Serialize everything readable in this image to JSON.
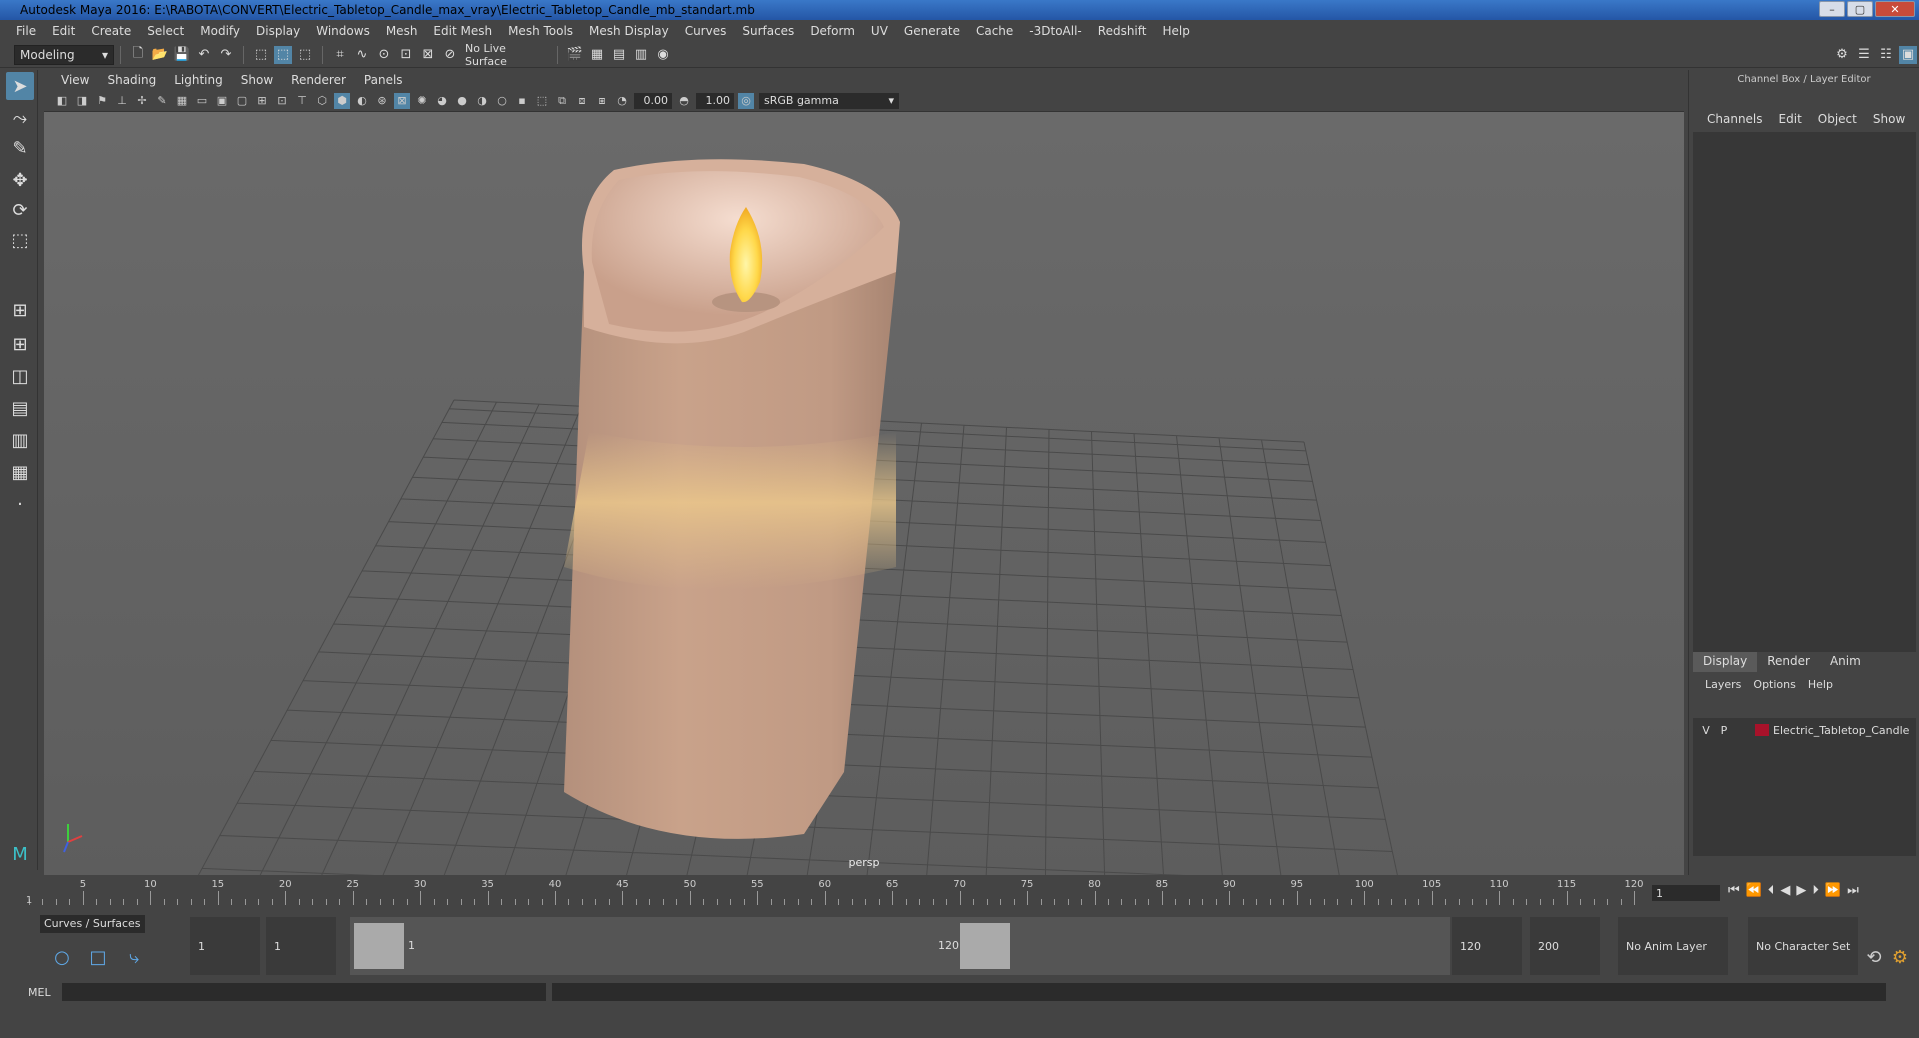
{
  "window": {
    "title": "Autodesk Maya 2016: E:\\RABOTA\\CONVERT\\Electric_Tabletop_Candle_max_vray\\Electric_Tabletop_Candle_mb_standart.mb",
    "minimize": "–",
    "maximize": "▢",
    "close": "✕"
  },
  "menubar": [
    "File",
    "Edit",
    "Create",
    "Select",
    "Modify",
    "Display",
    "Windows",
    "Mesh",
    "Edit Mesh",
    "Mesh Tools",
    "Mesh Display",
    "Curves",
    "Surfaces",
    "Deform",
    "UV",
    "Generate",
    "Cache",
    "-3DtoAll-",
    "Redshift",
    "Help"
  ],
  "toolbar": {
    "mode": "Modeling",
    "live_surface": "No Live Surface"
  },
  "panel": {
    "menu": [
      "View",
      "Shading",
      "Lighting",
      "Show",
      "Renderer",
      "Panels"
    ],
    "exposure": "0.00",
    "gamma": "1.00",
    "color_space": "sRGB gamma",
    "camera_label": "persp"
  },
  "channel_box": {
    "title": "Channel Box / Layer Editor",
    "menu": [
      "Channels",
      "Edit",
      "Object",
      "Show"
    ]
  },
  "layer_editor": {
    "tabs": [
      "Display",
      "Render",
      "Anim"
    ],
    "menu": [
      "Layers",
      "Options",
      "Help"
    ],
    "layers": [
      {
        "v": "V",
        "p": "P",
        "name": "Electric_Tabletop_Candle",
        "color": "#a8122a"
      }
    ]
  },
  "timeline": {
    "ticks": [
      "5",
      "10",
      "15",
      "20",
      "25",
      "30",
      "35",
      "40",
      "45",
      "50",
      "55",
      "60",
      "65",
      "70",
      "75",
      "80",
      "85",
      "90",
      "95",
      "100",
      "105",
      "110",
      "115",
      "120"
    ],
    "first_label": "1",
    "current_frame": "1"
  },
  "range": {
    "shelf_tab": "Curves / Surfaces",
    "start": "1",
    "playback_start": "1",
    "handle_start": "1",
    "handle_end": "120",
    "playback_end": "120",
    "end": "200",
    "anim_layer": "No Anim Layer",
    "character_set": "No Character Set"
  },
  "cmd": {
    "label": "MEL"
  },
  "colors": {
    "accent": "#5285a6",
    "layer_color": "#a8122a"
  }
}
